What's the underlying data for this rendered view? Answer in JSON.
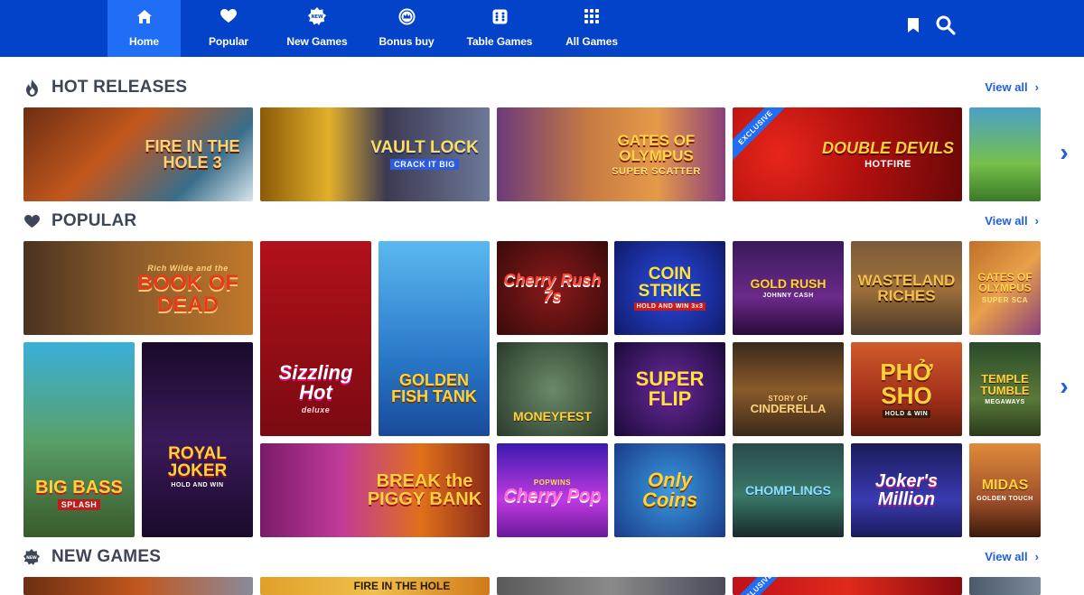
{
  "nav": {
    "tabs": [
      {
        "label": "Home",
        "icon": "home-icon"
      },
      {
        "label": "Popular",
        "icon": "heart-icon"
      },
      {
        "label": "New Games",
        "icon": "new-badge-icon"
      },
      {
        "label": "Bonus buy",
        "icon": "crown-coin-icon"
      },
      {
        "label": "Table Games",
        "icon": "dice-icon"
      },
      {
        "label": "All Games",
        "icon": "grid-icon"
      }
    ],
    "active": "Home",
    "right_icons": [
      "bookmark-icon",
      "search-icon"
    ]
  },
  "sections": {
    "hot": {
      "title": "HOT RELEASES",
      "icon": "flame-icon",
      "view_all": "View all",
      "games": [
        {
          "title": "FIRE IN THE HOLE 3",
          "sub": ""
        },
        {
          "title": "VAULT LOCK",
          "sub": "CRACK IT BIG"
        },
        {
          "title": "GATES OF OLYMPUS",
          "sub": "SUPER SCATTER"
        },
        {
          "title": "DOUBLE DEVILS",
          "sub": "HOTFIRE",
          "badge": "EXCLUSIVE"
        },
        {
          "title": "",
          "sub": ""
        }
      ]
    },
    "popular": {
      "title": "POPULAR",
      "icon": "heart-icon",
      "view_all": "View all",
      "games": [
        {
          "title": "BOOK OF DEAD",
          "sub": "Rich Wilde and the"
        },
        {
          "title": "Sizzling Hot",
          "sub": "deluxe"
        },
        {
          "title": "GOLDEN FISH TANK",
          "sub": ""
        },
        {
          "title": "Cherry Rush 7s",
          "sub": ""
        },
        {
          "title": "COIN STRIKE",
          "sub": "HOLD AND WIN 3x3"
        },
        {
          "title": "GOLD RUSH",
          "sub": "JOHNNY CASH"
        },
        {
          "title": "WASTELAND RICHES",
          "sub": ""
        },
        {
          "title": "GATES OF OLYMPUS",
          "sub": "SUPER SCA"
        },
        {
          "title": "BIG BASS",
          "sub": "SPLASH"
        },
        {
          "title": "ROYAL JOKER",
          "sub": "HOLD AND WIN"
        },
        {
          "title": "MONEYFEST",
          "sub": ""
        },
        {
          "title": "SUPER FLIP",
          "sub": ""
        },
        {
          "title": "CINDERELLA",
          "sub": "STORY OF"
        },
        {
          "title": "PHỞ SHO",
          "sub": "HOLD & WIN"
        },
        {
          "title": "TEMPLE TUMBLE",
          "sub": "MEGAWAYS"
        },
        {
          "title": "BREAK the PIGGY BANK",
          "sub": ""
        },
        {
          "title": "Cherry Pop",
          "sub": "POPWINS"
        },
        {
          "title": "Only Coins",
          "sub": ""
        },
        {
          "title": "CHOMPLINGS",
          "sub": ""
        },
        {
          "title": "Joker's Million",
          "sub": ""
        },
        {
          "title": "MIDAS",
          "sub": "GOLDEN TOUCH"
        }
      ]
    },
    "new": {
      "title": "NEW GAMES",
      "icon": "new-badge-icon",
      "view_all": "View all",
      "games": [
        {
          "title": "",
          "sub": ""
        },
        {
          "title": "FIRE IN THE HOLE",
          "sub": ""
        },
        {
          "title": "",
          "sub": ""
        },
        {
          "title": "",
          "sub": "",
          "badge": "EXCLUSIVE"
        },
        {
          "title": "",
          "sub": ""
        }
      ]
    }
  },
  "colors": {
    "nav_bg": "#0343c9",
    "nav_active": "#1f6ef5",
    "link": "#1f5fe0",
    "heading": "#3d4656"
  }
}
